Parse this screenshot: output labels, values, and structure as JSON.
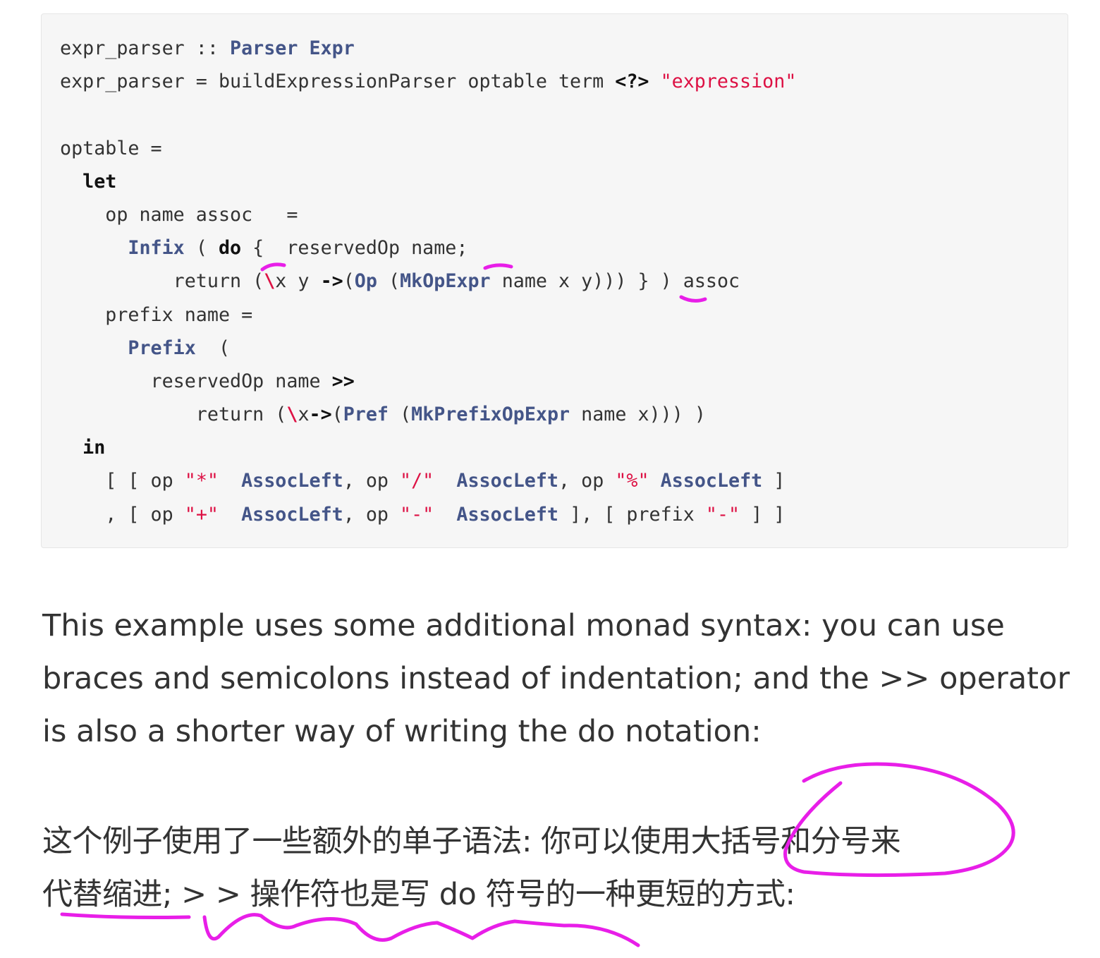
{
  "code": {
    "lines": [
      [
        {
          "t": "expr_parser :: ",
          "c": "plain"
        },
        {
          "t": "Parser Expr",
          "c": "ty"
        }
      ],
      [
        {
          "t": "expr_parser = buildExpressionParser optable term ",
          "c": "plain"
        },
        {
          "t": "<?>",
          "c": "kw"
        },
        {
          "t": " ",
          "c": "plain"
        },
        {
          "t": "\"expression\"",
          "c": "str"
        }
      ],
      [],
      [
        {
          "t": "optable =",
          "c": "plain"
        }
      ],
      [
        {
          "t": "  ",
          "c": "plain"
        },
        {
          "t": "let",
          "c": "kw"
        }
      ],
      [
        {
          "t": "    op name assoc   =",
          "c": "plain"
        }
      ],
      [
        {
          "t": "      ",
          "c": "plain"
        },
        {
          "t": "Infix",
          "c": "ty"
        },
        {
          "t": " ( ",
          "c": "plain"
        },
        {
          "t": "do",
          "c": "kw"
        },
        {
          "t": " {  reservedOp name;",
          "c": "plain"
        }
      ],
      [
        {
          "t": "          return (",
          "c": "plain"
        },
        {
          "t": "\\",
          "c": "esc"
        },
        {
          "t": "x y ",
          "c": "plain"
        },
        {
          "t": "->",
          "c": "kw"
        },
        {
          "t": "(",
          "c": "plain"
        },
        {
          "t": "Op",
          "c": "ty"
        },
        {
          "t": " (",
          "c": "plain"
        },
        {
          "t": "MkOpExpr",
          "c": "ty"
        },
        {
          "t": " name x y))) } ) assoc",
          "c": "plain"
        }
      ],
      [
        {
          "t": "    prefix name =",
          "c": "plain"
        }
      ],
      [
        {
          "t": "      ",
          "c": "plain"
        },
        {
          "t": "Prefix",
          "c": "ty"
        },
        {
          "t": "  (",
          "c": "plain"
        }
      ],
      [
        {
          "t": "        reservedOp name ",
          "c": "plain"
        },
        {
          "t": ">>",
          "c": "kw"
        }
      ],
      [
        {
          "t": "            return (",
          "c": "plain"
        },
        {
          "t": "\\",
          "c": "esc"
        },
        {
          "t": "x",
          "c": "plain"
        },
        {
          "t": "->",
          "c": "kw"
        },
        {
          "t": "(",
          "c": "plain"
        },
        {
          "t": "Pref",
          "c": "ty"
        },
        {
          "t": " (",
          "c": "plain"
        },
        {
          "t": "MkPrefixOpExpr",
          "c": "ty"
        },
        {
          "t": " name x))) )",
          "c": "plain"
        }
      ],
      [
        {
          "t": "  ",
          "c": "plain"
        },
        {
          "t": "in",
          "c": "kw"
        }
      ],
      [
        {
          "t": "    [ [ op ",
          "c": "plain"
        },
        {
          "t": "\"*\"",
          "c": "str"
        },
        {
          "t": "  ",
          "c": "plain"
        },
        {
          "t": "AssocLeft",
          "c": "ty"
        },
        {
          "t": ", op ",
          "c": "plain"
        },
        {
          "t": "\"/\"",
          "c": "str"
        },
        {
          "t": "  ",
          "c": "plain"
        },
        {
          "t": "AssocLeft",
          "c": "ty"
        },
        {
          "t": ", op ",
          "c": "plain"
        },
        {
          "t": "\"%\"",
          "c": "str"
        },
        {
          "t": " ",
          "c": "plain"
        },
        {
          "t": "AssocLeft",
          "c": "ty"
        },
        {
          "t": " ]",
          "c": "plain"
        }
      ],
      [
        {
          "t": "    , [ op ",
          "c": "plain"
        },
        {
          "t": "\"+\"",
          "c": "str"
        },
        {
          "t": "  ",
          "c": "plain"
        },
        {
          "t": "AssocLeft",
          "c": "ty"
        },
        {
          "t": ", op ",
          "c": "plain"
        },
        {
          "t": "\"-\"",
          "c": "str"
        },
        {
          "t": "  ",
          "c": "plain"
        },
        {
          "t": "AssocLeft",
          "c": "ty"
        },
        {
          "t": " ], [ prefix ",
          "c": "plain"
        },
        {
          "t": "\"-\"",
          "c": "str"
        },
        {
          "t": " ] ]",
          "c": "plain"
        }
      ]
    ]
  },
  "paragraph_en": {
    "line1": "This example uses some additional monad syntax: you can use",
    "line2": "braces and semicolons instead of indentation; and the >> operator",
    "line3": "is also a shorter way of writing the do notation:"
  },
  "paragraph_zh": {
    "line1": "这个例子使用了一些额外的单子语法: 你可以使用大括号和分号来",
    "line2": "代替缩进; > > 操作符也是写 do 符号的一种更短的方式:"
  },
  "colors": {
    "code_background": "#f6f6f6",
    "keyword": "#111111",
    "type": "#445588",
    "string": "#dd1144",
    "annotation": "#e81ee8"
  }
}
